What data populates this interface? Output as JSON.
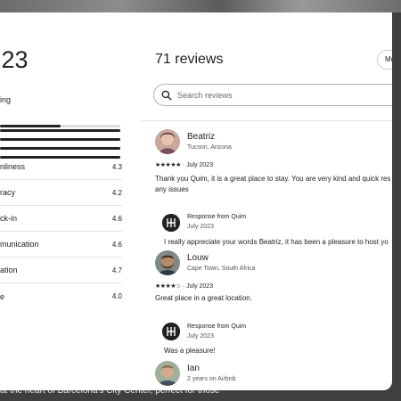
{
  "left": {
    "overall_rating": ".23",
    "breakdown_label": "ing",
    "rating_distribution": [
      0.5,
      1.0,
      1.0,
      1.0,
      1.0
    ],
    "categories": [
      {
        "label": "nliness",
        "value": "4.3"
      },
      {
        "label": "racy",
        "value": "4.2"
      },
      {
        "label": "ck-in",
        "value": "4.6"
      },
      {
        "label": "munication",
        "value": "4.6"
      },
      {
        "label": "ation",
        "value": "4.7"
      },
      {
        "label": "e",
        "value": "4.0"
      }
    ]
  },
  "header": {
    "reviews_count_title": "71 reviews",
    "sort_label": "Most"
  },
  "search": {
    "placeholder": "Search reviews"
  },
  "reviews": [
    {
      "name": "Beatriz",
      "location": "Tucson, Arizona",
      "stars": "★★★★★",
      "date": "· July 2023",
      "text_line1": "Thank you Quim, it is a great place to stay. You are very kind and quick res",
      "text_line2": "any issues",
      "response_from": "Response from Quim",
      "response_date": "July 2023",
      "response_text": "I really appreciate your words Beatriz, it has been a pleasure to host yo"
    },
    {
      "name": "Louw",
      "location": "Cape Town, South Africa",
      "stars": "★★★★☆",
      "date": "· July 2023",
      "text_line1": "Great place in a great location.",
      "response_from": "Response from Quim",
      "response_date": "July 2023",
      "response_text": "Was a pleasure!"
    },
    {
      "name": "Ian",
      "location": "2 years on Airbnb"
    }
  ],
  "background": {
    "listing_text": "at the heart of Barcelona's City Center, perfect for those"
  }
}
